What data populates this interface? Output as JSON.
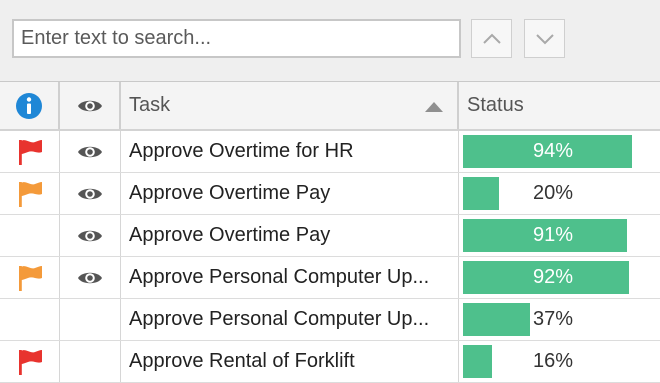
{
  "search": {
    "placeholder": "Enter text to search..."
  },
  "header": {
    "task_label": "Task",
    "status_label": "Status"
  },
  "colors": {
    "status_bar": "#4ec08c",
    "flag_high": "#e8332e",
    "flag_medium": "#f49a3a",
    "info": "#1f87d6"
  },
  "rows": [
    {
      "flag": "red",
      "watched": true,
      "task": "Approve Overtime for HR",
      "status_label": "94%",
      "status": 0.94
    },
    {
      "flag": "orange",
      "watched": true,
      "task": "Approve Overtime Pay",
      "status_label": "20%",
      "status": 0.2
    },
    {
      "flag": "none",
      "watched": true,
      "task": "Approve Overtime Pay",
      "status_label": "91%",
      "status": 0.91
    },
    {
      "flag": "orange",
      "watched": true,
      "task": "Approve Personal Computer Up...",
      "status_label": "92%",
      "status": 0.92
    },
    {
      "flag": "none",
      "watched": false,
      "task": "Approve Personal Computer Up...",
      "status_label": "37%",
      "status": 0.37
    },
    {
      "flag": "red",
      "watched": false,
      "task": "Approve Rental of Forklift",
      "status_label": "16%",
      "status": 0.16
    }
  ]
}
